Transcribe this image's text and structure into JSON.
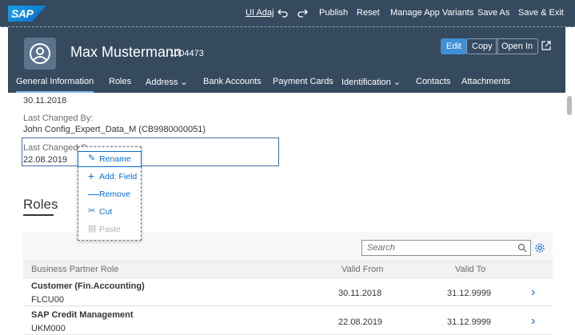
{
  "shell": {
    "ui_adapt": "UI Adaj",
    "publish": "Publish",
    "reset": "Reset",
    "manage_app_variants": "Manage App Variants",
    "save_as": "Save As",
    "save_exit": "Save & Exit",
    "logo": "SAP"
  },
  "header": {
    "name": "Max Mustermann",
    "id": "1004473",
    "edit": "Edit",
    "copy": "Copy",
    "open_in": "Open In"
  },
  "tabs": [
    "General Information",
    "Roles",
    "Address",
    "Bank Accounts",
    "Payment Cards",
    "Identification",
    "Contacts",
    "Attachments"
  ],
  "general": {
    "created_on_value": "30.11.2018",
    "last_changed_by_label": "Last Changed By:",
    "last_changed_by_value": "John Config_Expert_Data_M (CB9980000051)",
    "last_changed_on_label": "Last Changed O",
    "last_changed_on_value": "22.08.2019"
  },
  "context_menu": {
    "rename": "Rename",
    "add_field": "Add: Field",
    "remove": "Remove",
    "cut": "Cut",
    "paste": "Paste"
  },
  "roles": {
    "title": "Roles",
    "search_placeholder": "Search",
    "columns": [
      "Business Partner Role",
      "Valid From",
      "Valid To"
    ],
    "rows": [
      {
        "role": "Customer (Fin.Accounting)",
        "code": "FLCU00",
        "from": "30.11.2018",
        "to": "31.12.9999"
      },
      {
        "role": "SAP Credit Management",
        "code": "UKM000",
        "from": "22.08.2019",
        "to": "31.12.9999"
      }
    ]
  }
}
